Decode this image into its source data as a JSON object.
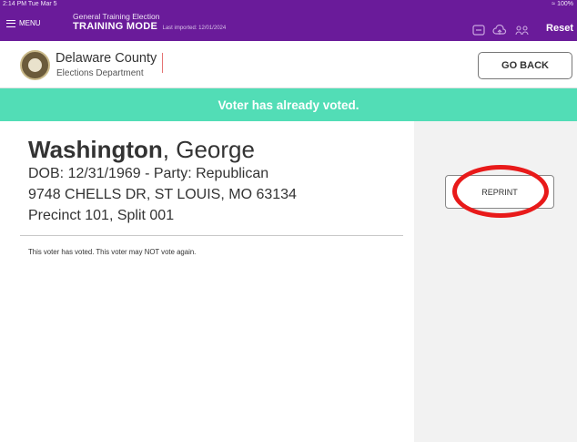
{
  "status_bar": {
    "time": "2:14 PM  Tue Mar 5",
    "battery": "100%"
  },
  "topbar": {
    "menu_label": "MENU",
    "election_name": "General Training Election",
    "mode": "TRAINING MODE",
    "last_imported": "Last imported: 12/01/2024",
    "reset_label": "Reset",
    "icons": [
      "tablet-sync-icon",
      "cloud-upload-icon",
      "users-icon"
    ]
  },
  "header": {
    "county": "Delaware County",
    "department": "Elections Department",
    "go_back_label": "GO BACK"
  },
  "banner": {
    "message": "Voter has already voted.",
    "color": "#52ddb6"
  },
  "voter": {
    "last_name": "Washington",
    "first_name": ", George",
    "dob_party": "DOB: 12/31/1969 - Party: Republican",
    "address": "9748 CHELLS DR, ST LOUIS, MO 63134",
    "precinct": "Precinct 101, Split 001",
    "note": "This voter has voted.  This voter may NOT vote again."
  },
  "actions": {
    "reprint_label": "REPRINT"
  },
  "colors": {
    "topbar": "#6a1b9a",
    "banner": "#52ddb6",
    "highlight_circle": "#e81a1a"
  }
}
